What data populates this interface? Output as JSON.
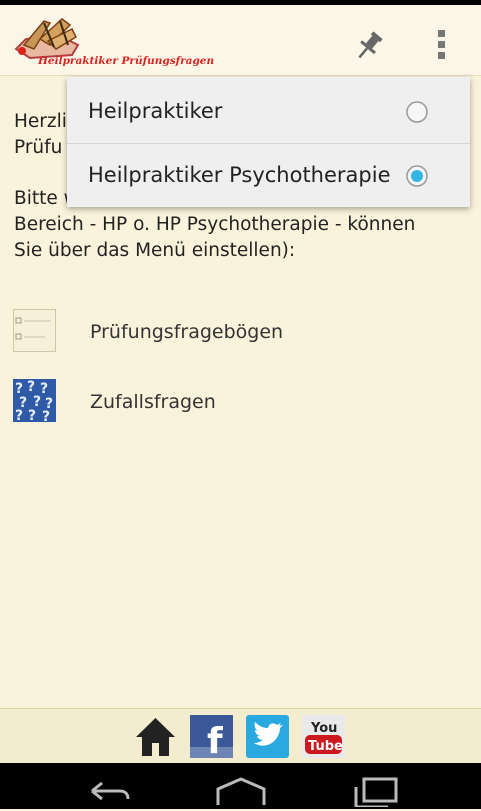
{
  "app": {
    "logo_text": "Heilpraktiker Prüfungsfragen"
  },
  "actionbar": {
    "pin_icon": "pin-icon",
    "overflow_icon": "overflow-menu-icon"
  },
  "content": {
    "intro_visible_line1": "Herzli",
    "intro_visible_line2": "Prüfu",
    "intro2_line1": "Bitte w",
    "intro2_line2": "Bereich - HP o. HP Psychotherapie - können",
    "intro2_line3": "Sie über das Menü einstellen):"
  },
  "menu": {
    "items": [
      {
        "label": "Prüfungsfragebögen",
        "icon": "questionnaire-icon"
      },
      {
        "label": "Zufallsfragen",
        "icon": "question-marks-icon"
      }
    ]
  },
  "dropdown": {
    "options": [
      {
        "label": "Heilpraktiker",
        "selected": false
      },
      {
        "label": "Heilpraktiker Psychotherapie",
        "selected": true
      }
    ]
  },
  "footer": {
    "icons": [
      "home-icon",
      "facebook-icon",
      "twitter-icon",
      "youtube-icon"
    ],
    "facebook_glyph": "f",
    "youtube_you": "You",
    "youtube_tube": "Tube"
  },
  "navbar": {
    "icons": [
      "back-icon",
      "home-nav-icon",
      "recents-icon"
    ]
  },
  "colors": {
    "accent": "#33b5e5",
    "logo_red": "#d9231f",
    "background": "#faf3dc"
  }
}
